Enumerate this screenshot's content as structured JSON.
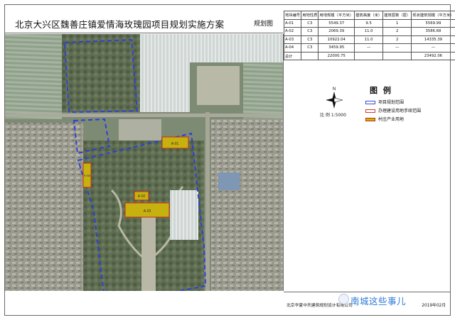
{
  "title": "北京大兴区魏善庄镇爱情海玫瑰园项目规划实施方案",
  "sheet_label": "规划图",
  "table": {
    "headers": [
      "地块编号",
      "用地性质",
      "用地规模（平方米）",
      "建筑高度（米）",
      "建筑层数（层）",
      "现状建筑规模（平方米）"
    ],
    "rows": [
      [
        "A-01",
        "C3",
        "5549.37",
        "9.5",
        "1",
        "5569.99"
      ],
      [
        "A-02",
        "C3",
        "2069.39",
        "11.0",
        "2",
        "3586.68"
      ],
      [
        "A-03",
        "C3",
        "10922.04",
        "11.0",
        "2",
        "14335.39"
      ],
      [
        "A-04",
        "C3",
        "3459.95",
        "—",
        "—",
        "—"
      ],
      [
        "总计",
        "",
        "22000.75",
        "",
        "",
        "23492.06"
      ]
    ]
  },
  "north_label": "N",
  "scale_text": "比  例  1:5000",
  "legend": {
    "title": "图 例",
    "items": [
      {
        "label": "项目规划范围",
        "color": "#3a4bd0"
      },
      {
        "label": "办理建设用地手续范围",
        "color": "#d23a2a"
      },
      {
        "label": "村庄产业用地",
        "color": "#c8b80a"
      }
    ]
  },
  "map": {
    "plots": [
      {
        "label": "A-01"
      },
      {
        "label": "A-02"
      },
      {
        "label": "A-03"
      },
      {
        "label": "A-04"
      }
    ],
    "boundary_color": "#2e3fd8",
    "plot_fill": "#c6b10e",
    "plot_stroke": "#c82a1a"
  },
  "footer": {
    "company": "北京华夏中天建筑规划设计有限公司",
    "date": "2019年02月"
  },
  "watermark": "南城这些事儿"
}
